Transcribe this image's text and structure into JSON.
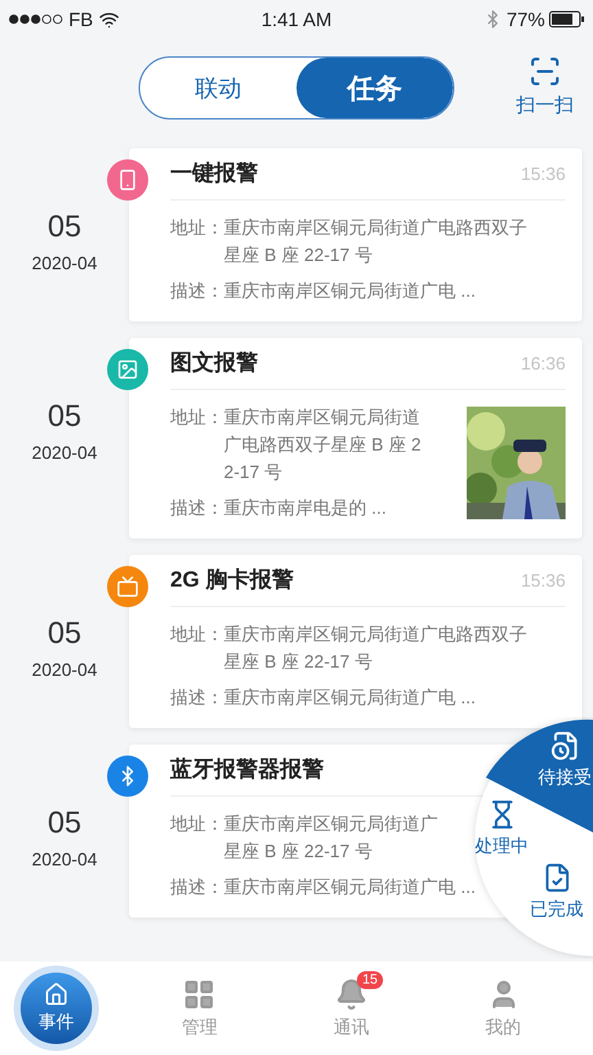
{
  "status_bar": {
    "carrier": "FB",
    "time": "1:41 AM",
    "battery": "77%"
  },
  "segments": [
    {
      "label": "联动",
      "selected": false
    },
    {
      "label": "任务",
      "selected": true
    }
  ],
  "scan_button": "扫一扫",
  "events": [
    {
      "day": "05",
      "month": "2020-04",
      "kind": "one-key",
      "color": "#f2678e",
      "title": "一键报警",
      "time": "15:36",
      "address_label": "地址：",
      "address_lines": [
        "重庆市南岸区铜元局街道广电路西双子",
        "星座 B 座 22-17 号"
      ],
      "description_label": "描述：",
      "description": "重庆市南岸区铜元局街道广电 ..."
    },
    {
      "day": "05",
      "month": "2020-04",
      "color": "#19b8a8",
      "title": "图文报警",
      "time": "16:36",
      "address_label": "地址：",
      "address_lines": [
        "重庆市南岸区铜元局街道",
        "广电路西双子星座 B 座 2",
        "2-17 号"
      ],
      "description_label": "描述：",
      "description": "重庆市南岸电是的 ...",
      "photo": {
        "kind": "picture"
      }
    },
    {
      "day": "05",
      "month": "2020-04",
      "kind": "badge",
      "color": "#f5870f",
      "title": "2G 胸卡报警",
      "time": "15:36",
      "address_label": "地址：",
      "address_lines": [
        "重庆市南岸区铜元局街道广电路西双子",
        "星座 B 座 22-17 号"
      ],
      "description_label": "描述：",
      "description": "重庆市南岸区铜元局街道广电 ..."
    },
    {
      "day": "05",
      "month": "2020-04",
      "kind": "bluetooth",
      "color": "#1a84e6",
      "title": "蓝牙报警器报警",
      "address_label": "地址：",
      "address_lines": [
        "重庆市南岸区铜元局街道广",
        "星座 B 座 22-17 号"
      ],
      "description_label": "描述：",
      "description": "重庆市南岸区铜元局街道广电 ..."
    }
  ],
  "status_menu": [
    {
      "label": "待接受",
      "selected": true
    },
    {
      "label": "处理中",
      "selected": false
    },
    {
      "label": "已完成",
      "selected": false
    }
  ],
  "tabs": [
    {
      "label": "事件",
      "selected": true
    },
    {
      "label": "管理",
      "selected": false
    },
    {
      "label": "通讯",
      "selected": false,
      "badge": "15"
    },
    {
      "label": "我的",
      "selected": false
    }
  ]
}
